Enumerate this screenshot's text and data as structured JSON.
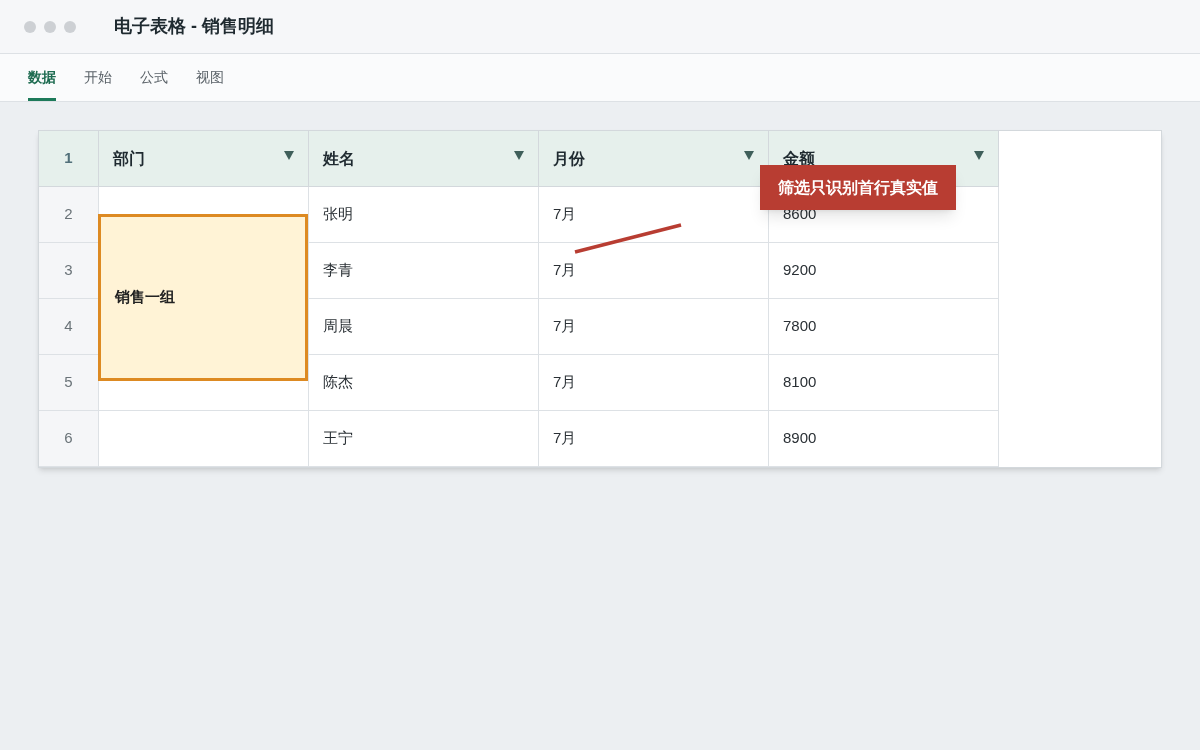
{
  "window": {
    "title": "电子表格 - 销售明细"
  },
  "tabs": [
    {
      "label": "数据",
      "selected": true
    },
    {
      "label": "开始",
      "selected": false
    },
    {
      "label": "公式",
      "selected": false
    },
    {
      "label": "视图",
      "selected": false
    }
  ],
  "table": {
    "header_number": "1",
    "columns": [
      {
        "label": "部门",
        "filter": true
      },
      {
        "label": "姓名",
        "filter": true
      },
      {
        "label": "月份",
        "filter": true
      },
      {
        "label": "金额",
        "filter": true
      }
    ],
    "rows": [
      {
        "number": "2",
        "cells": [
          null,
          "张明",
          "7月",
          "8600"
        ]
      },
      {
        "number": "3",
        "cells": [
          null,
          "李青",
          "7月",
          "9200"
        ]
      },
      {
        "number": "4",
        "cells": [
          null,
          "周晨",
          "7月",
          "7800"
        ]
      },
      {
        "number": "5",
        "cells": [
          null,
          "陈杰",
          "7月",
          "8100"
        ]
      },
      {
        "number": "6",
        "cells": [
          null,
          "王宁",
          "7月",
          "8900"
        ]
      }
    ],
    "merged_cell": {
      "text": "销售一组"
    }
  },
  "callout": {
    "text": "筛选只识别首行真实值"
  }
}
